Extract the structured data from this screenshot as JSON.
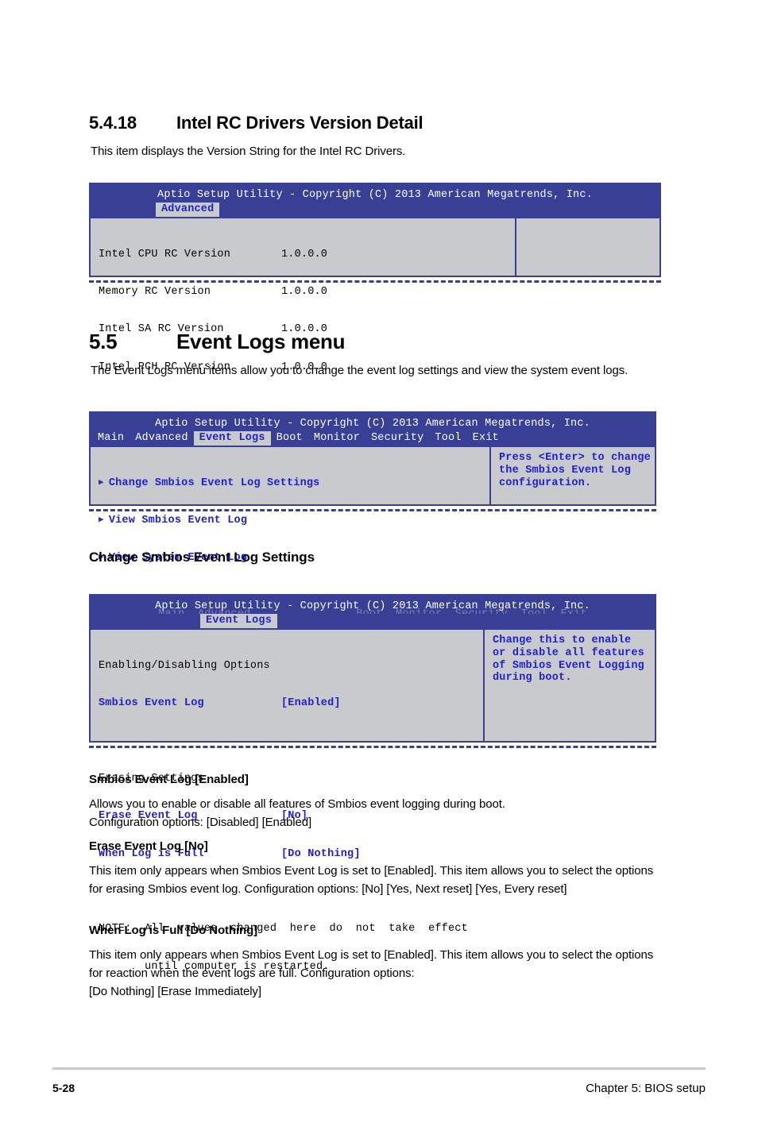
{
  "section_5_4_18": {
    "number": "5.4.18",
    "title": "Intel RC Drivers Version Detail",
    "paragraph": "This item displays the Version String for the Intel RC Drivers."
  },
  "bios_rc_versions": {
    "header_title": "Aptio Setup Utility - Copyright (C) 2013 American Megatrends, Inc.",
    "active_tab": "Advanced",
    "rows": [
      {
        "label": "Intel CPU RC Version",
        "value": "1.0.0.0"
      },
      {
        "label": "Memory RC Version",
        "value": "1.0.0.0"
      },
      {
        "label": "Intel SA RC Version",
        "value": "1.0.0.0"
      },
      {
        "label": "Intel PCH RC Version",
        "value": "1.0.0.0"
      }
    ],
    "help_text": ""
  },
  "section_5_5": {
    "number": "5.5",
    "title": "Event Logs menu",
    "paragraph": "The Event Logs menu items allow you to change the event log settings and view the system event logs."
  },
  "bios_event_logs": {
    "header_title": "Aptio Setup Utility - Copyright (C) 2013 American Megatrends, Inc.",
    "tabs": [
      "Main",
      "Advanced",
      "Event Logs",
      "Boot",
      "Monitor",
      "Security",
      "Tool",
      "Exit"
    ],
    "active_tab": "Event Logs",
    "menu_items": [
      "Change Smbios Event Log Settings",
      "View Smbios Event Log",
      "View System Event Log"
    ],
    "help_text": "Press <Enter> to change\nthe Smbios Event Log\nconfiguration."
  },
  "subsection_change_smbios": {
    "title": "Change Smbios Event Log Settings"
  },
  "bios_smbios_settings": {
    "header_title": "Aptio Setup Utility - Copyright (C) 2013 American Megatrends, Inc.",
    "ghost_tabs": "Main  Advanced                Boot  Monitor  Security  Tool  Exit",
    "active_tab": "Event Logs",
    "group1_title": "Enabling/Disabling Options",
    "group1_rows": [
      {
        "label": "Smbios Event Log",
        "value": "[Enabled]"
      }
    ],
    "group2_title": "Erasing Settings",
    "group2_rows": [
      {
        "label": "Erase Event Log",
        "value": "[No]"
      },
      {
        "label": "When Log is Full",
        "value": "[Do Nothing]"
      }
    ],
    "note_line1": "NOTE:  All  values  changed  here  do  not  take  effect",
    "note_line2": "       until computer is restarted.",
    "help_text": "Change this to enable\nor disable all features\nof Smbios Event Logging\nduring boot."
  },
  "item_smbios_event_log": {
    "heading": "Smbios Event Log [Enabled]",
    "paragraph": "Allows you to enable or disable all features of Smbios event logging during boot.\nConfiguration options: [Disabled] [Enabled]"
  },
  "item_erase_event_log": {
    "heading": "Erase Event Log [No]",
    "paragraph": "This item only appears when Smbios Event Log is set to [Enabled]. This item allows you to select the options for erasing Smbios event log. Configuration options: [No] [Yes, Next reset] [Yes, Every reset]"
  },
  "item_when_log_is_full": {
    "heading": "When Log is Full [Do Nothing]",
    "paragraph": "This item only appears when Smbios Event Log is set to [Enabled]. This item allows you to select the options for reaction when the event logs are full. Configuration options:\n[Do Nothing] [Erase Immediately]"
  },
  "footer": {
    "page_number": "5-28",
    "chapter": "Chapter 5: BIOS setup"
  },
  "colors": {
    "bios_header_blue": "#3a3f96",
    "bios_panel_gray": "#c9cacd",
    "bios_text_blue": "#2020cc",
    "footer_rule_gray": "#c9c9c9"
  }
}
